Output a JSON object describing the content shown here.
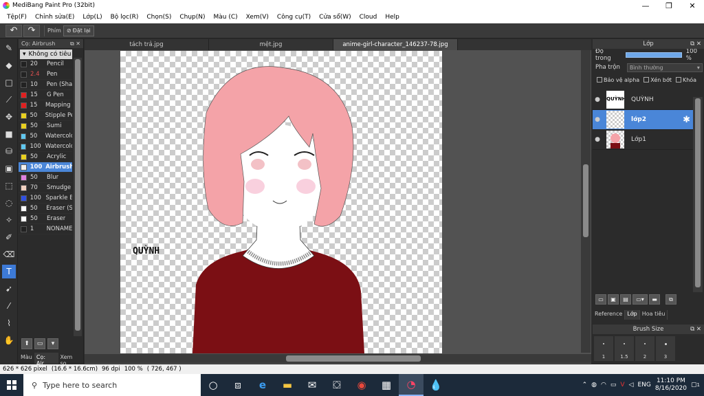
{
  "window": {
    "title": "MediBang Paint Pro (32bit)",
    "min": "—",
    "max": "❐",
    "close": "✕"
  },
  "menu": [
    "Tệp(F)",
    "Chỉnh sửa(E)",
    "Lớp(L)",
    "Bộ lọc(R)",
    "Chọn(S)",
    "Chụp(N)",
    "Màu (C)",
    "Xem(V)",
    "Công cụ(T)",
    "Cửa sổ(W)",
    "Cloud",
    "Help"
  ],
  "toolbar": {
    "undo_icon": "undo-icon",
    "redo_icon": "redo-icon",
    "shortcut_label": "Phím",
    "reset_label": "Đặt lại"
  },
  "tools": [
    "brush-icon",
    "eraser-icon",
    "rectangle-icon",
    "pen-icon",
    "move-icon",
    "fill-rect-icon",
    "bucket-icon",
    "gradient-icon",
    "select-rect-icon",
    "lasso-icon",
    "magic-wand-icon",
    "select-pen-icon",
    "select-eraser-icon",
    "text-icon",
    "operation-icon",
    "eyedropper-icon",
    "dropper-icon",
    "hand-icon"
  ],
  "brush_panel": {
    "title": "Cọ: Airbrush",
    "group": "Không có tiêu",
    "brushes": [
      {
        "size": "20",
        "name": "Pencil",
        "color": "#222222"
      },
      {
        "size": "2.4",
        "name": "Pen",
        "color": "#222222",
        "size_color": "#e05050"
      },
      {
        "size": "10",
        "name": "Pen (Sha",
        "color": "#222222"
      },
      {
        "size": "15",
        "name": "G Pen",
        "color": "#e02020"
      },
      {
        "size": "15",
        "name": "Mapping I",
        "color": "#e02020"
      },
      {
        "size": "50",
        "name": "Stipple Pe",
        "color": "#e8d020"
      },
      {
        "size": "50",
        "name": "Sumi",
        "color": "#e8d020"
      },
      {
        "size": "50",
        "name": "Watercolo",
        "color": "#60c8f0"
      },
      {
        "size": "100",
        "name": "Watercolo",
        "color": "#60c8f0"
      },
      {
        "size": "50",
        "name": "Acrylic",
        "color": "#e8d020"
      },
      {
        "size": "100",
        "name": "Airbrush",
        "color": "#f0f0f0",
        "selected": true
      },
      {
        "size": "50",
        "name": "Blur",
        "color": "#e080e0"
      },
      {
        "size": "70",
        "name": "Smudge",
        "color": "#f0d0c0"
      },
      {
        "size": "100",
        "name": "Sparkle B",
        "color": "#3050e0"
      },
      {
        "size": "50",
        "name": "Eraser (S",
        "color": "#ffffff"
      },
      {
        "size": "50",
        "name": "Eraser",
        "color": "#ffffff"
      },
      {
        "size": "1",
        "name": "NONAME",
        "color": "#222222"
      }
    ],
    "tabs": [
      "Màu",
      "Cọ: Air...",
      "Xem so..."
    ]
  },
  "doc_tabs": [
    "tách trả.jpg",
    "mệt.jpg",
    "anime-girl-character_146237-78.jpg"
  ],
  "canvas_text": "QUỲNH",
  "colors": {
    "hair": "#f4a3a8",
    "shirt": "#7b0f14",
    "skin": "#ffffff",
    "accent": "#4a86d8"
  },
  "layer_panel": {
    "title": "Lớp",
    "opacity_label": "Độ trong",
    "opacity_value": "100 %",
    "opacity": 1.0,
    "blend_label": "Pha trộn",
    "blend_value": "Bình thường",
    "checks": [
      "Bảo vệ alpha",
      "Xén bớt",
      "Khóa"
    ],
    "layers": [
      {
        "name": "QUỲNH",
        "thumb_text": "QUỲNH",
        "selected": false
      },
      {
        "name": "lớp2",
        "selected": true
      },
      {
        "name": "Lớp1",
        "selected": false
      }
    ],
    "bottom_tabs": [
      "Reference",
      "Lớp",
      "Hoa tiêu"
    ]
  },
  "brush_size": {
    "title": "Brush Size",
    "sizes": [
      "1",
      "1.5",
      "2",
      "3"
    ]
  },
  "status": {
    "size": "626 * 626 pixel",
    "cm": "(16.6 * 16.6cm)",
    "dpi": "96 dpi",
    "zoom": "100 %",
    "coords": "( 726, 467 )"
  },
  "taskbar": {
    "search_placeholder": "Type here to search",
    "lang": "ENG",
    "time": "11:10 PM",
    "date": "8/16/2020",
    "notif": "1"
  }
}
